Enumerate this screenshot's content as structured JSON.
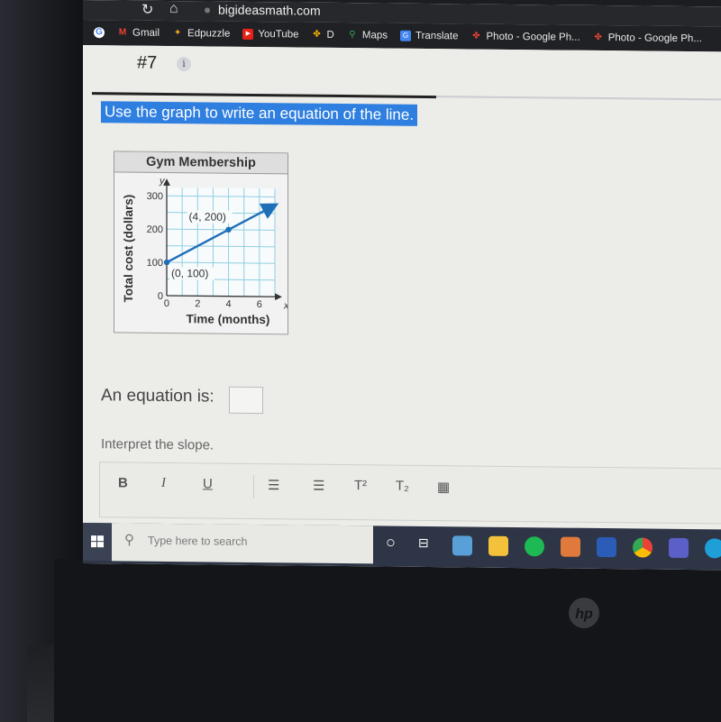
{
  "browser": {
    "url": "bigideasmath.com",
    "bookmarks": [
      {
        "label": "",
        "icon": "google-icon"
      },
      {
        "label": "Gmail",
        "icon": "gmail-icon"
      },
      {
        "label": "Edpuzzle",
        "icon": "edpuzzle-icon"
      },
      {
        "label": "YouTube",
        "icon": "youtube-icon"
      },
      {
        "label": "D",
        "icon": "google-photos-icon"
      },
      {
        "label": "Maps",
        "icon": "maps-icon"
      },
      {
        "label": "Translate",
        "icon": "translate-icon"
      },
      {
        "label": "Photo - Google Ph...",
        "icon": "google-photos-icon"
      },
      {
        "label": "Photo - Google Ph...",
        "icon": "google-photos-icon"
      }
    ]
  },
  "question": {
    "number": "#7",
    "info_icon": "i",
    "prompt": "Use the graph to write an equation of the line.",
    "equation_label": "An equation is:",
    "equation_value": "",
    "interpret_label": "Interpret the slope."
  },
  "editor_toolbar": {
    "bold": "B",
    "italic": "I",
    "underline": "U",
    "superscript": "T²",
    "subscript": "T₂"
  },
  "taskbar": {
    "search_placeholder": "Type here to search"
  },
  "chart_data": {
    "type": "line",
    "title": "Gym Membership",
    "xlabel": "Time (months)",
    "ylabel": "Total cost (dollars)",
    "x_axis_symbol": "x",
    "y_axis_symbol": "y",
    "xlim": [
      0,
      7
    ],
    "ylim": [
      0,
      325
    ],
    "x_ticks": [
      0,
      2,
      4,
      6
    ],
    "y_ticks": [
      0,
      100,
      200,
      300
    ],
    "x_grid_step": 1,
    "y_grid_step": 50,
    "grid": true,
    "series": [
      {
        "name": "Total cost",
        "x": [
          0,
          4,
          7
        ],
        "y": [
          100,
          200,
          275
        ],
        "arrow_end": true
      }
    ],
    "points": [
      {
        "x": 0,
        "y": 100,
        "label": "(0, 100)"
      },
      {
        "x": 4,
        "y": 200,
        "label": "(4, 200)"
      }
    ]
  },
  "colors": {
    "line": "#1f6fb8",
    "grid": "#8fcfe3",
    "highlight": "#2f7fe0"
  }
}
